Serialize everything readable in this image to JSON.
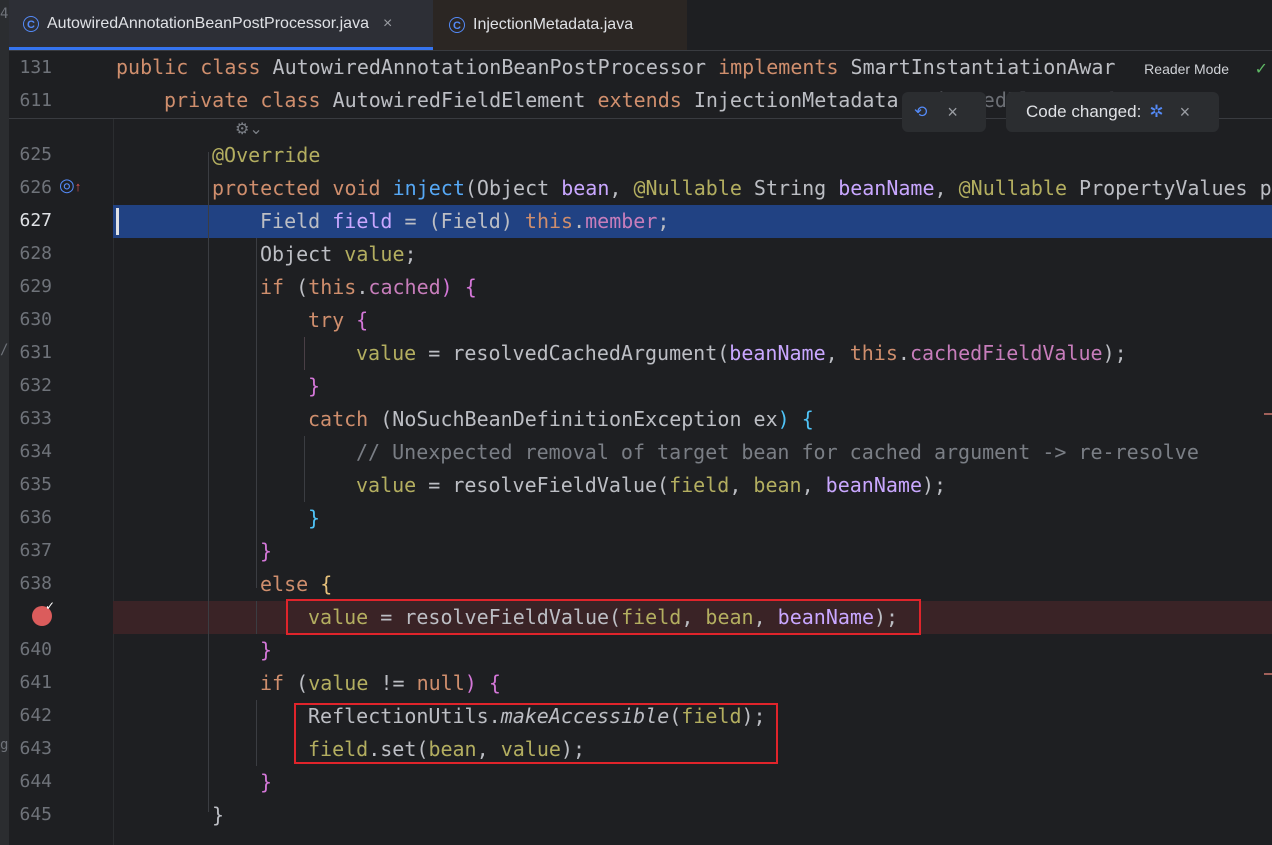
{
  "tabs": [
    {
      "label": "AutowiredAnnotationBeanPostProcessor.java",
      "close": "×",
      "active": true
    },
    {
      "label": "InjectionMetadata.java",
      "active": false
    }
  ],
  "reader_mode": "Reader Mode",
  "code_changed_popup": {
    "label": "Code changed:",
    "close": "×"
  },
  "hint_popup_close": "×",
  "sticky_lines": [
    {
      "number": "131",
      "text": "public class AutowiredAnnotationBeanPostProcessor implements SmartInstantiationAware"
    },
    {
      "number": "611",
      "text": "private class AutowiredFieldElement extends InjectionMetadata.InjectedElement {"
    }
  ],
  "line_numbers": [
    "625",
    "626",
    "627",
    "628",
    "629",
    "630",
    "631",
    "632",
    "633",
    "634",
    "635",
    "636",
    "637",
    "638",
    "",
    "640",
    "641",
    "642",
    "643",
    "644",
    "645"
  ],
  "current_line": "627",
  "code": {
    "l625": "@Override",
    "l626_kw1": "protected",
    "l626_kw2": "void",
    "l626_fn": "inject",
    "l626_rest1": "(Object ",
    "l626_p1": "bean",
    "l626_rest2": ", ",
    "l626_ann1": "@Nullable",
    "l626_rest3": " String ",
    "l626_p2": "beanName",
    "l626_rest4": ", ",
    "l626_ann2": "@Nullable",
    "l626_rest5": " PropertyValues pv",
    "l627_a": "Field ",
    "l627_var": "field",
    "l627_b": " = (Field) ",
    "l627_this": "this",
    "l627_dot": ".",
    "l627_member": "member",
    "l627_end": ";",
    "l628_a": "Object ",
    "l628_var": "value",
    "l628_end": ";",
    "l629_if": "if",
    "l629_open": " (",
    "l629_this": "this",
    "l629_dot": ".",
    "l629_cached": "cached",
    "l629_close": ") {",
    "l630_try": "try",
    "l630_brace": " {",
    "l631_var": "value",
    "l631_a": " = resolvedCachedArgument(",
    "l631_p": "beanName",
    "l631_b": ", ",
    "l631_this": "this",
    "l631_dot": ".",
    "l631_fld": "cachedFieldValue",
    "l631_end": ");",
    "l632": "}",
    "l633_catch": "catch",
    "l633_a": " (NoSuchBeanDefinitionException ",
    "l633_ex": "ex",
    "l633_b": ") {",
    "l634": "// Unexpected removal of target bean for cached argument -> re-resolve",
    "l635_var": "value",
    "l635_a": " = resolveFieldValue(",
    "l635_f": "field",
    "l635_b": ", ",
    "l635_bean": "bean",
    "l635_c": ", ",
    "l635_bn": "beanName",
    "l635_end": ");",
    "l636": "}",
    "l637": "}",
    "l638_else": "else",
    "l638_brace": " {",
    "l639_var": "value",
    "l639_a": " = resolveFieldValue(",
    "l639_f": "field",
    "l639_b": ", ",
    "l639_bean": "bean",
    "l639_c": ", ",
    "l639_bn": "beanName",
    "l639_end": ");",
    "l640": "}",
    "l641_if": "if",
    "l641_open": " (",
    "l641_var": "value",
    "l641_a": " != ",
    "l641_null": "null",
    "l641_b": ") {",
    "l642_a": "ReflectionUtils.",
    "l642_m": "makeAccessible",
    "l642_b": "(",
    "l642_f": "field",
    "l642_end": ");",
    "l643_f": "field",
    "l643_a": ".set(",
    "l643_bean": "bean",
    "l643_b": ", ",
    "l643_v": "value",
    "l643_end": ");",
    "l644": "}",
    "l645": "}"
  },
  "left_strip_chars": [
    "4",
    "",
    "",
    "",
    "",
    "",
    "",
    "",
    "",
    "",
    "",
    "",
    "/",
    "",
    "",
    "",
    "",
    "",
    "",
    "",
    "",
    "",
    "",
    "",
    "g",
    ""
  ],
  "colors": {
    "background": "#1e1f22",
    "selection": "#214283",
    "breakpoint_line": "#3a2326",
    "annotation_box": "#e0242b",
    "keyword": "#cf8e6d",
    "function": "#56a8f5",
    "field": "#c77dbb",
    "parameter": "#c9a7ff",
    "annotation": "#b3ae60",
    "comment": "#7a7e85"
  },
  "icons": {
    "tab_class": "class-c-icon",
    "breakpoint": "breakpoint-icon",
    "override": "override-icon",
    "debug": "debug-reload-icon",
    "check": "check-icon"
  }
}
